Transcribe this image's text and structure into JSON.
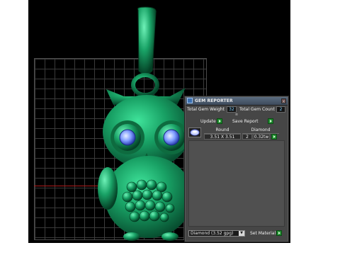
{
  "panel": {
    "title": "GEM REPORTER",
    "close_glyph": "x",
    "total_gem_weight_label": "Total Gem Weight",
    "total_gem_weight_value": "32",
    "total_gem_count_label": "Total Gem Count",
    "total_gem_count_value": "2",
    "expand_glyph": "≡",
    "update_label": "Update",
    "save_report_label": "Save Report",
    "table": {
      "headers": [
        "Round",
        "Diamond"
      ],
      "row": {
        "size": "3.51 X 3.51",
        "count": "2",
        "weight": "0.32tw"
      }
    },
    "material_select_value": "Diamond  (3.52 gpg)",
    "set_material_label": "Set Material"
  },
  "colors": {
    "model_green": "#1ea56a",
    "gem_blue": "#7ea2ff",
    "go_button": "#1f8a2e",
    "axis_red": "#b01c1c"
  },
  "icons": [
    "app-icon",
    "close-icon",
    "go-arrow-icon",
    "gem-thumbnail-icon",
    "dropdown-arrow-icon"
  ]
}
